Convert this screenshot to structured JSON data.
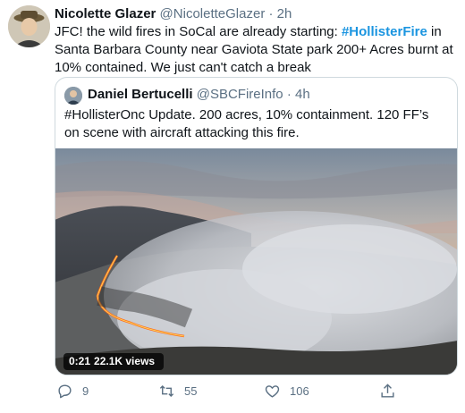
{
  "tweet": {
    "author_name": "Nicolette Glazer",
    "author_handle": "@NicoletteGlazer",
    "separator": "·",
    "time": "2h",
    "text_before": "JFC! the wild fires in SoCal are already starting: ",
    "hashtag": "#HollisterFire",
    "text_after": " in Santa Barbara County near Gaviota State park 200+ Acres burnt at 10% contained. We just can't catch a break"
  },
  "quoted_tweet": {
    "author_name": "Daniel Bertucelli",
    "author_handle": "@SBCFireInfo",
    "separator": "·",
    "time": "4h",
    "text": "#HollisterOnc Update. 200 acres, 10% containment. 120 FF’s on scene with aircraft attacking this fire.",
    "video": {
      "duration": "0:21",
      "views": "22.1K views"
    }
  },
  "actions": {
    "reply_count": "9",
    "retweet_count": "55",
    "like_count": "106",
    "reply_icon": "reply-icon",
    "retweet_icon": "retweet-icon",
    "like_icon": "heart-icon",
    "share_icon": "share-icon"
  },
  "colors": {
    "hashtag": "#1b95e0",
    "secondary_text": "#5b7083",
    "border": "#cfd9de"
  }
}
